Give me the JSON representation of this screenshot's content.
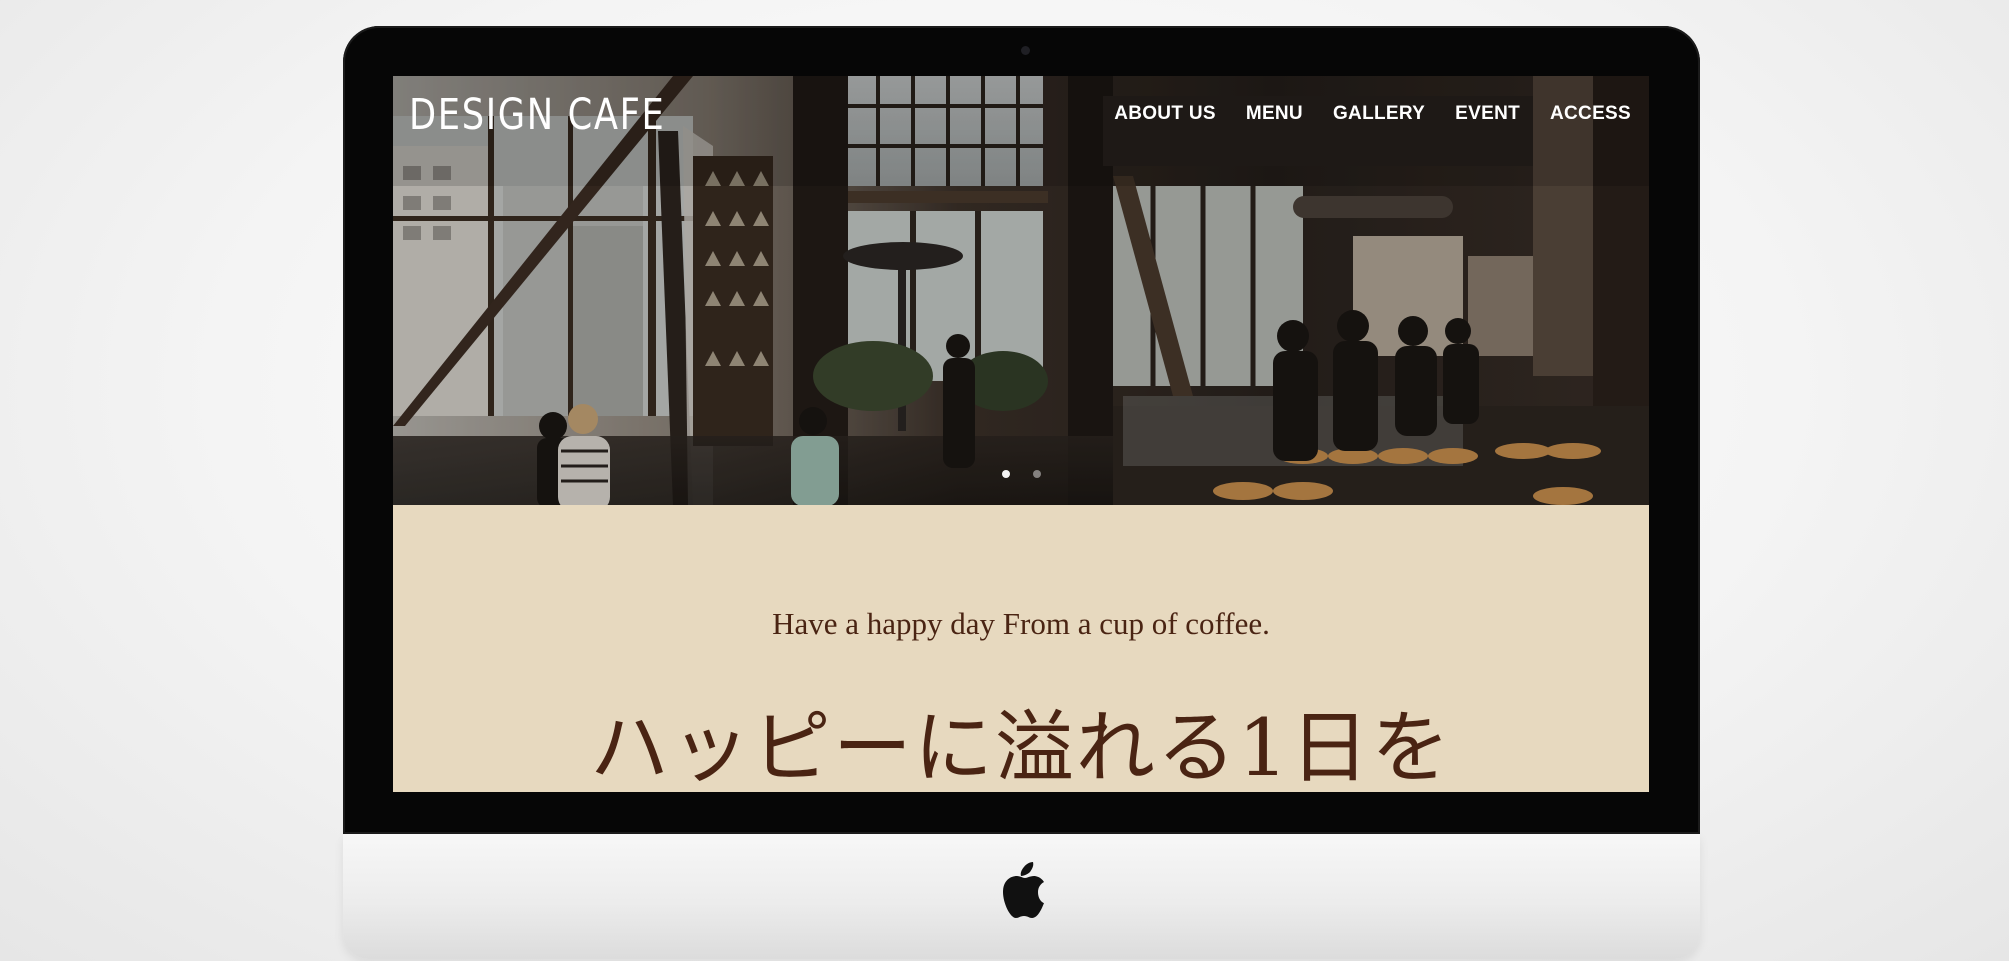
{
  "site": {
    "logo": "DESIGN CAFE",
    "nav": [
      "ABOUT US",
      "MENU",
      "GALLERY",
      "EVENT",
      "ACCESS"
    ],
    "slider": {
      "slides": 2,
      "active": 1
    },
    "tagline": "Have a happy day From a cup of coffee.",
    "headline": "ハッピーに溢れる1日を"
  },
  "colors": {
    "intro_background": "#e7d9bf",
    "text_brown": "#4a2413",
    "nav_text": "#ffffff",
    "bezel": "#060606"
  },
  "icons": {
    "brand": "apple-logo-icon"
  }
}
